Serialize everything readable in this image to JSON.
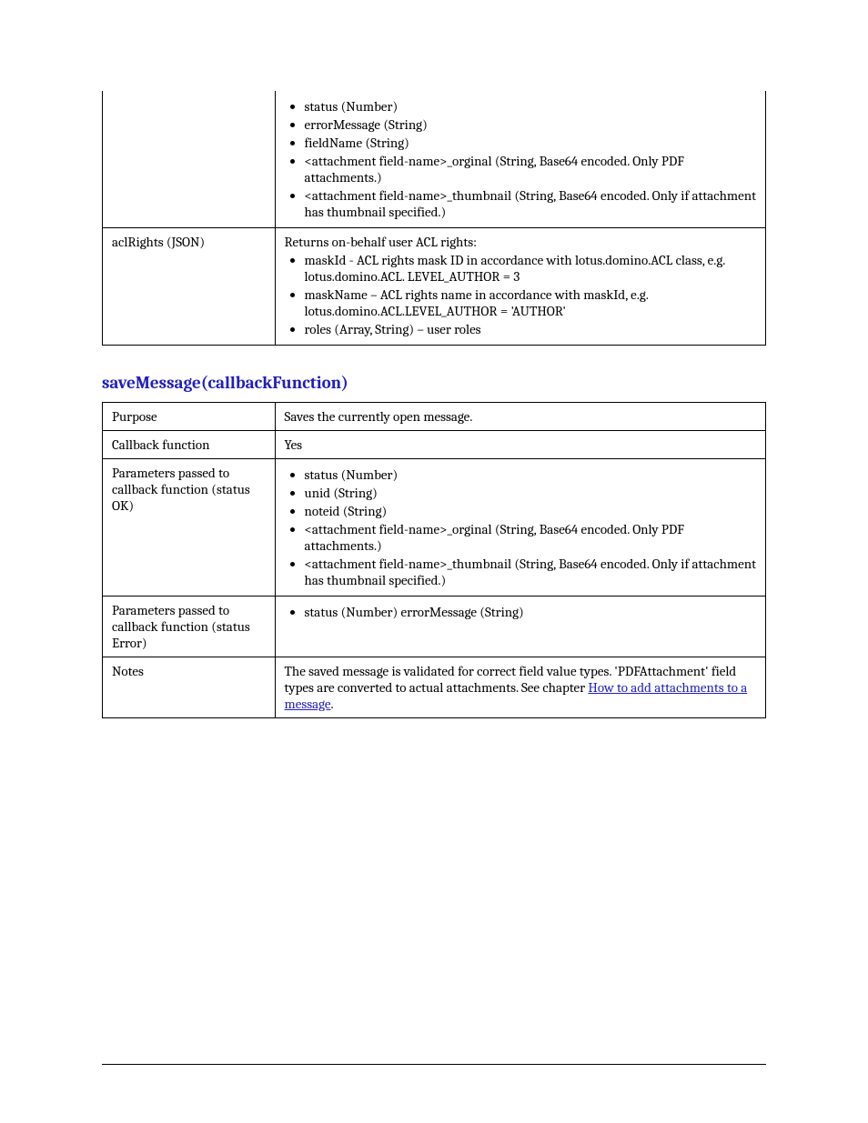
{
  "table_continued": {
    "row_attachments": {
      "label": "",
      "items": [
        "status (Number)",
        "errorMessage (String)",
        "fieldName (String)",
        "<attachment field-name>_orginal (String, Base64 encoded. Only PDF attachments.)",
        "<attachment field-name>_thumbnail (String, Base64 encoded. Only if attachment has thumbnail specified.)"
      ]
    },
    "row_aclrights": {
      "label": "aclRights (JSON)",
      "intro": "Returns on-behalf user ACL rights:",
      "items": [
        "maskId - ACL rights mask ID in accordance with lotus.domino.ACL class, e.g. lotus.domino.ACL. LEVEL_AUTHOR = 3",
        "maskName – ACL rights name in accordance with maskId, e.g. lotus.domino.ACL.LEVEL_AUTHOR = 'AUTHOR'",
        "roles (Array, String) – user roles"
      ]
    }
  },
  "heading_saveMessage": "saveMessage(callbackFunction)",
  "table_saveMessage": {
    "row_purpose": {
      "label": "Purpose",
      "value": "Saves the currently open message."
    },
    "row_callback": {
      "label": "Callback function",
      "value": "Yes"
    },
    "row_ok": {
      "label": "Parameters passed to callback function (status OK)",
      "items": [
        "status (Number)",
        "unid (String)",
        "noteid (String)",
        "<attachment field-name>_orginal (String, Base64 encoded. Only PDF attachments.)",
        "<attachment field-name>_thumbnail (String, Base64 encoded. Only if attachment has thumbnail specified.)"
      ]
    },
    "row_error": {
      "label": "Parameters passed to callback function (status Error)",
      "items": [
        "status (Number) errorMessage (String)"
      ]
    },
    "row_notes": {
      "label": "Notes",
      "value_pre": "The saved message is validated for correct field value types. 'PDFAttachment' field types are converted to actual attachments. See chapter ",
      "link_text": "How to add attachments to a message",
      "value_post": "."
    }
  }
}
